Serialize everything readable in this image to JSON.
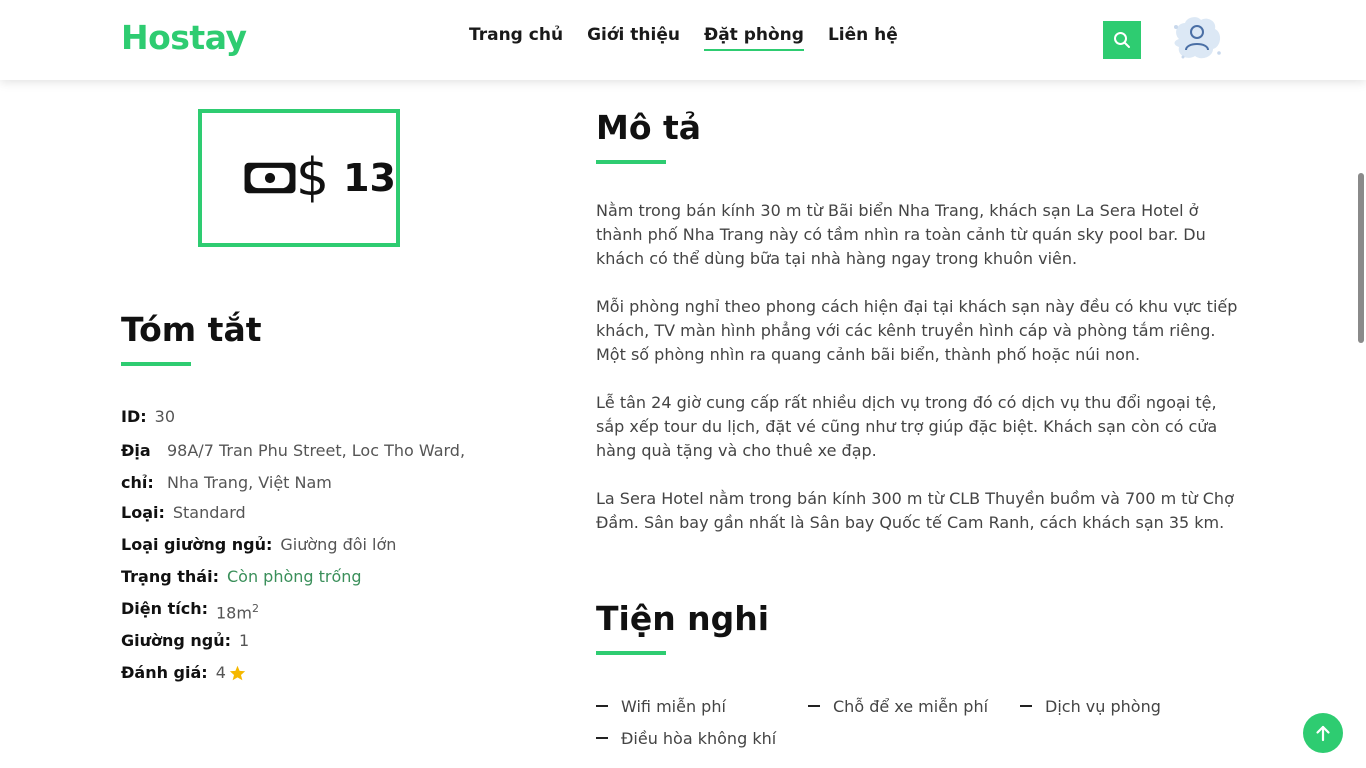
{
  "header": {
    "logo": "Hostay",
    "nav": [
      "Trang chủ",
      "Giới thiệu",
      "Đặt phòng",
      "Liên hệ"
    ],
    "active_nav": "Đặt phòng"
  },
  "price": {
    "currency_symbol": "$",
    "value": "13",
    "icon": "money-icon"
  },
  "summary": {
    "title": "Tóm tắt",
    "rows": [
      {
        "label": "ID:",
        "value": "30"
      },
      {
        "label": "Địa chỉ:",
        "value": "98A/7 Tran Phu Street, Loc Tho Ward, Nha Trang, Việt Nam"
      },
      {
        "label": "Loại:",
        "value": "Standard"
      },
      {
        "label": "Loại giường ngủ:",
        "value": "Giường đôi lớn"
      },
      {
        "label": "Trạng thái:",
        "value": "Còn phòng trống"
      },
      {
        "label": "Diện tích:",
        "value": "18m",
        "sup": "2"
      },
      {
        "label": "Giường ngủ:",
        "value": "1"
      },
      {
        "label": "Đánh giá:",
        "value": "4",
        "icon": "star-icon"
      }
    ]
  },
  "description": {
    "title": "Mô tả",
    "paragraphs": [
      "Nằm trong bán kính 30 m từ Bãi biển Nha Trang, khách sạn La Sera Hotel ở thành phố Nha Trang này có tầm nhìn ra toàn cảnh từ quán sky pool bar. Du khách có thể dùng bữa tại nhà hàng ngay trong khuôn viên.",
      "Mỗi phòng nghỉ theo phong cách hiện đại tại khách sạn này đều có khu vực tiếp khách, TV màn hình phẳng với các kênh truyền hình cáp và phòng tắm riêng. Một số phòng nhìn ra quang cảnh bãi biển, thành phố hoặc núi non.",
      "Lễ tân 24 giờ cung cấp rất nhiều dịch vụ trong đó có dịch vụ thu đổi ngoại tệ, sắp xếp tour du lịch, đặt vé cũng như trợ giúp đặc biệt. Khách sạn còn có cửa hàng quà tặng và cho thuê xe đạp.",
      "La Sera Hotel nằm trong bán kính 300 m từ CLB Thuyền buồm và 700 m từ Chợ Đầm. Sân bay gần nhất là Sân bay Quốc tế Cam Ranh, cách khách sạn 35 km."
    ]
  },
  "amenities": {
    "title": "Tiện nghi",
    "items": [
      "Wifi miễn phí",
      "Chỗ để xe miễn phí",
      "Dịch vụ phòng",
      "Điều hòa không khí"
    ]
  },
  "colors": {
    "accent": "#2ecc71",
    "status": "#3a8f5a",
    "star": "#f5b800"
  }
}
